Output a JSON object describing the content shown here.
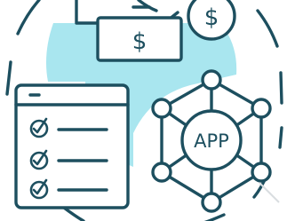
{
  "icon": {
    "name": "mobile-app-payment-checklist-icon",
    "colors": {
      "stroke": "#1d4f5f",
      "accent": "#a9e6ef",
      "background": "#ffffff"
    }
  },
  "labels": {
    "dollar_banknote": "$",
    "dollar_coin": "$",
    "app_hub": "APP"
  },
  "checklist": {
    "items": [
      {
        "checked": true
      },
      {
        "checked": true
      },
      {
        "checked": true
      }
    ]
  }
}
